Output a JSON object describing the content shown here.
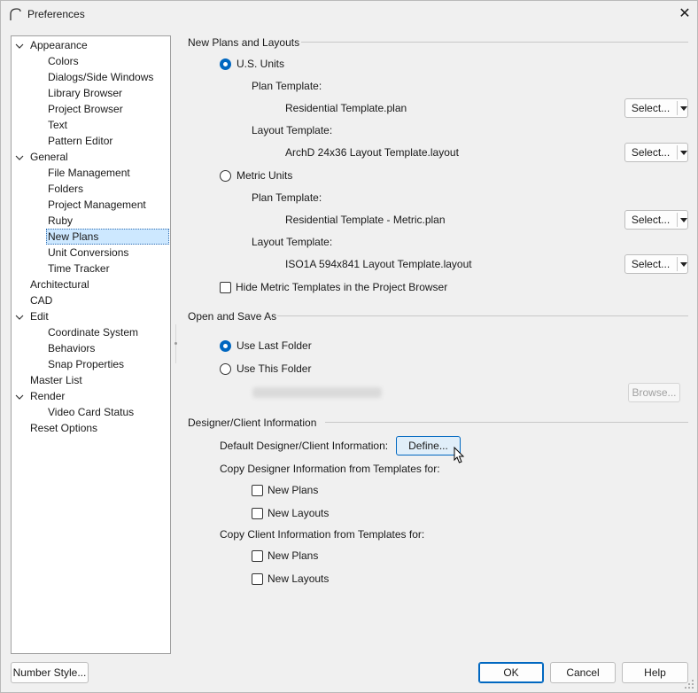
{
  "window": {
    "title": "Preferences"
  },
  "tree": {
    "items": [
      {
        "label": "Appearance",
        "level": 0,
        "expanded": true
      },
      {
        "label": "Colors",
        "level": 1
      },
      {
        "label": "Dialogs/Side Windows",
        "level": 1
      },
      {
        "label": "Library Browser",
        "level": 1
      },
      {
        "label": "Project Browser",
        "level": 1
      },
      {
        "label": "Text",
        "level": 1
      },
      {
        "label": "Pattern Editor",
        "level": 1
      },
      {
        "label": "General",
        "level": 0,
        "expanded": true
      },
      {
        "label": "File Management",
        "level": 1
      },
      {
        "label": "Folders",
        "level": 1
      },
      {
        "label": "Project Management",
        "level": 1
      },
      {
        "label": "Ruby",
        "level": 1
      },
      {
        "label": "New Plans",
        "level": 1,
        "selected": true
      },
      {
        "label": "Unit Conversions",
        "level": 1
      },
      {
        "label": "Time Tracker",
        "level": 1
      },
      {
        "label": "Architectural",
        "level": 0
      },
      {
        "label": "CAD",
        "level": 0
      },
      {
        "label": "Edit",
        "level": 0,
        "expanded": true
      },
      {
        "label": "Coordinate System",
        "level": 1
      },
      {
        "label": "Behaviors",
        "level": 1
      },
      {
        "label": "Snap Properties",
        "level": 1
      },
      {
        "label": "Master List",
        "level": 0
      },
      {
        "label": "Render",
        "level": 0,
        "expanded": true
      },
      {
        "label": "Video Card Status",
        "level": 1
      },
      {
        "label": "Reset Options",
        "level": 0
      }
    ]
  },
  "new_plans": {
    "title": "New Plans and Layouts",
    "us_units": {
      "label": "U.S. Units",
      "selected": true
    },
    "us_plan_template_label": "Plan Template:",
    "us_plan_template_value": "Residential Template.plan",
    "us_layout_template_label": "Layout Template:",
    "us_layout_template_value": "ArchD 24x36 Layout Template.layout",
    "metric_units": {
      "label": "Metric Units",
      "selected": false
    },
    "metric_plan_template_label": "Plan Template:",
    "metric_plan_template_value": "Residential Template - Metric.plan",
    "metric_layout_template_label": "Layout Template:",
    "metric_layout_template_value": "ISO1A 594x841 Layout Template.layout",
    "select_label": "Select...",
    "hide_metric_label": "Hide Metric Templates in the Project Browser",
    "hide_metric_checked": false
  },
  "open_save": {
    "title": "Open and Save As",
    "use_last_folder": "Use Last Folder",
    "use_last_selected": true,
    "use_this_folder": "Use This Folder",
    "browse_label": "Browse..."
  },
  "designer": {
    "title": "Designer/Client Information",
    "default_label": "Default Designer/Client Information:",
    "define_label": "Define...",
    "copy_designer_label": "Copy Designer Information from Templates for:",
    "copy_client_label": "Copy Client Information from Templates for:",
    "new_plans": "New Plans",
    "new_layouts": "New Layouts"
  },
  "footer": {
    "number_style": "Number Style...",
    "ok": "OK",
    "cancel": "Cancel",
    "help": "Help"
  },
  "colors": {
    "accent": "#0067c0",
    "selection_bg": "#cde8ff"
  }
}
